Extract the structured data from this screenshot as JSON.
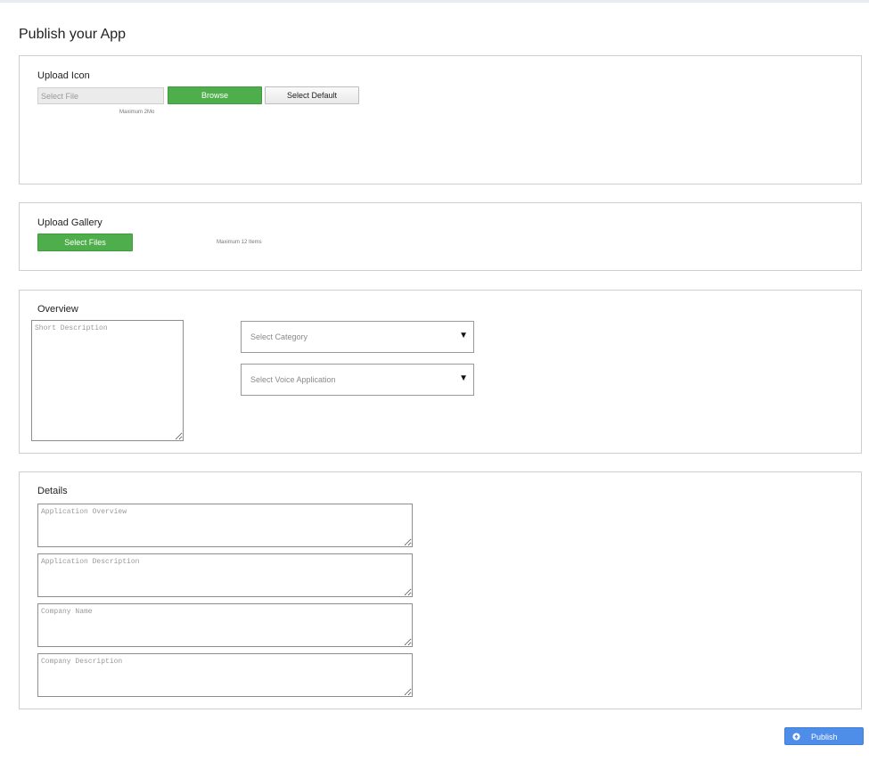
{
  "page": {
    "title": "Publish your App"
  },
  "upload_icon": {
    "title": "Upload Icon",
    "file_placeholder": "Select File",
    "browse_label": "Browse",
    "default_label": "Select Default",
    "hint": "Maximum 2Mo"
  },
  "upload_gallery": {
    "title": "Upload Gallery",
    "select_files_label": "Select Files",
    "hint": "Maximum 12 Items"
  },
  "overview": {
    "title": "Overview",
    "short_description_placeholder": "Short Description",
    "category_select": "Select Category",
    "voice_select": "Select Voice Application"
  },
  "details": {
    "title": "Details",
    "fields": [
      {
        "placeholder": "Application Overview"
      },
      {
        "placeholder": "Application Description"
      },
      {
        "placeholder": "Company Name"
      },
      {
        "placeholder": "Company Description"
      }
    ]
  },
  "actions": {
    "publish_label": "Publish",
    "publish_icon": "upload-cloud-icon"
  },
  "colors": {
    "green_button": "#4fae4c",
    "blue_button": "#4f8ee8",
    "panel_border": "#cfcfcf"
  }
}
